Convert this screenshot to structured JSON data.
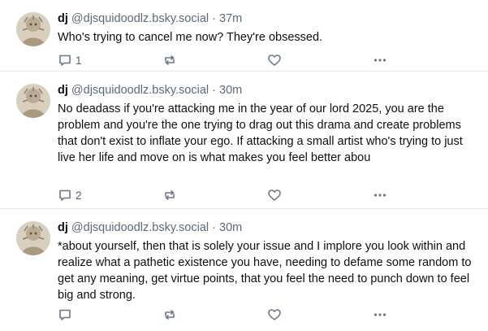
{
  "posts": [
    {
      "name": "dj",
      "handle": "@djsquidoodlz.bsky.social",
      "separator": "·",
      "time": "37m",
      "text": "Who's trying to cancel me now? They're obsessed.",
      "replies": "1",
      "reposts": "",
      "likes": ""
    },
    {
      "name": "dj",
      "handle": "@djsquidoodlz.bsky.social",
      "separator": "·",
      "time": "30m",
      "text": "No deadass if you're attacking me in the year of our lord 2025, you are the problem and you're the one trying to drag out this drama and create problems that don't exist to inflate your ego. If attacking a small artist who's trying to just live her life and move on is what makes you feel better abou",
      "replies": "2",
      "reposts": "",
      "likes": ""
    },
    {
      "name": "dj",
      "handle": "@djsquidoodlz.bsky.social",
      "separator": "·",
      "time": "30m",
      "text": "*about yourself, then that is solely your issue and I implore you look within and realize what a pathetic existence you have, needing to defame some random to get any meaning, get virtue points, that you feel the need to punch down to feel big and strong.",
      "replies": "",
      "reposts": "",
      "likes": ""
    }
  ],
  "icons": {
    "reply": "reply-icon",
    "repost": "repost-icon",
    "like": "heart-icon",
    "more": "more-options-icon"
  },
  "colors": {
    "text": "#0b0f14",
    "muted": "#5b6b7b",
    "icon": "#6a7a8b",
    "divider": "#e6e9ee"
  }
}
